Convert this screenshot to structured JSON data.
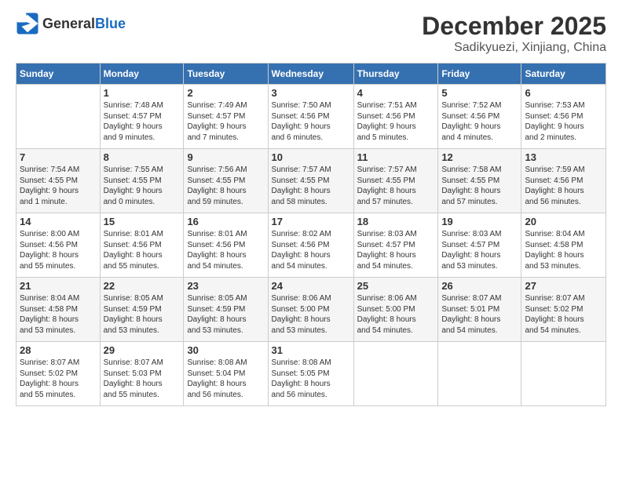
{
  "header": {
    "logo_general": "General",
    "logo_blue": "Blue",
    "title": "December 2025",
    "location": "Sadikyuezi, Xinjiang, China"
  },
  "days_of_week": [
    "Sunday",
    "Monday",
    "Tuesday",
    "Wednesday",
    "Thursday",
    "Friday",
    "Saturday"
  ],
  "weeks": [
    [
      {
        "day": "",
        "info": ""
      },
      {
        "day": "1",
        "info": "Sunrise: 7:48 AM\nSunset: 4:57 PM\nDaylight: 9 hours\nand 9 minutes."
      },
      {
        "day": "2",
        "info": "Sunrise: 7:49 AM\nSunset: 4:57 PM\nDaylight: 9 hours\nand 7 minutes."
      },
      {
        "day": "3",
        "info": "Sunrise: 7:50 AM\nSunset: 4:56 PM\nDaylight: 9 hours\nand 6 minutes."
      },
      {
        "day": "4",
        "info": "Sunrise: 7:51 AM\nSunset: 4:56 PM\nDaylight: 9 hours\nand 5 minutes."
      },
      {
        "day": "5",
        "info": "Sunrise: 7:52 AM\nSunset: 4:56 PM\nDaylight: 9 hours\nand 4 minutes."
      },
      {
        "day": "6",
        "info": "Sunrise: 7:53 AM\nSunset: 4:56 PM\nDaylight: 9 hours\nand 2 minutes."
      }
    ],
    [
      {
        "day": "7",
        "info": "Sunrise: 7:54 AM\nSunset: 4:55 PM\nDaylight: 9 hours\nand 1 minute."
      },
      {
        "day": "8",
        "info": "Sunrise: 7:55 AM\nSunset: 4:55 PM\nDaylight: 9 hours\nand 0 minutes."
      },
      {
        "day": "9",
        "info": "Sunrise: 7:56 AM\nSunset: 4:55 PM\nDaylight: 8 hours\nand 59 minutes."
      },
      {
        "day": "10",
        "info": "Sunrise: 7:57 AM\nSunset: 4:55 PM\nDaylight: 8 hours\nand 58 minutes."
      },
      {
        "day": "11",
        "info": "Sunrise: 7:57 AM\nSunset: 4:55 PM\nDaylight: 8 hours\nand 57 minutes."
      },
      {
        "day": "12",
        "info": "Sunrise: 7:58 AM\nSunset: 4:55 PM\nDaylight: 8 hours\nand 57 minutes."
      },
      {
        "day": "13",
        "info": "Sunrise: 7:59 AM\nSunset: 4:56 PM\nDaylight: 8 hours\nand 56 minutes."
      }
    ],
    [
      {
        "day": "14",
        "info": "Sunrise: 8:00 AM\nSunset: 4:56 PM\nDaylight: 8 hours\nand 55 minutes."
      },
      {
        "day": "15",
        "info": "Sunrise: 8:01 AM\nSunset: 4:56 PM\nDaylight: 8 hours\nand 55 minutes."
      },
      {
        "day": "16",
        "info": "Sunrise: 8:01 AM\nSunset: 4:56 PM\nDaylight: 8 hours\nand 54 minutes."
      },
      {
        "day": "17",
        "info": "Sunrise: 8:02 AM\nSunset: 4:56 PM\nDaylight: 8 hours\nand 54 minutes."
      },
      {
        "day": "18",
        "info": "Sunrise: 8:03 AM\nSunset: 4:57 PM\nDaylight: 8 hours\nand 54 minutes."
      },
      {
        "day": "19",
        "info": "Sunrise: 8:03 AM\nSunset: 4:57 PM\nDaylight: 8 hours\nand 53 minutes."
      },
      {
        "day": "20",
        "info": "Sunrise: 8:04 AM\nSunset: 4:58 PM\nDaylight: 8 hours\nand 53 minutes."
      }
    ],
    [
      {
        "day": "21",
        "info": "Sunrise: 8:04 AM\nSunset: 4:58 PM\nDaylight: 8 hours\nand 53 minutes."
      },
      {
        "day": "22",
        "info": "Sunrise: 8:05 AM\nSunset: 4:59 PM\nDaylight: 8 hours\nand 53 minutes."
      },
      {
        "day": "23",
        "info": "Sunrise: 8:05 AM\nSunset: 4:59 PM\nDaylight: 8 hours\nand 53 minutes."
      },
      {
        "day": "24",
        "info": "Sunrise: 8:06 AM\nSunset: 5:00 PM\nDaylight: 8 hours\nand 53 minutes."
      },
      {
        "day": "25",
        "info": "Sunrise: 8:06 AM\nSunset: 5:00 PM\nDaylight: 8 hours\nand 54 minutes."
      },
      {
        "day": "26",
        "info": "Sunrise: 8:07 AM\nSunset: 5:01 PM\nDaylight: 8 hours\nand 54 minutes."
      },
      {
        "day": "27",
        "info": "Sunrise: 8:07 AM\nSunset: 5:02 PM\nDaylight: 8 hours\nand 54 minutes."
      }
    ],
    [
      {
        "day": "28",
        "info": "Sunrise: 8:07 AM\nSunset: 5:02 PM\nDaylight: 8 hours\nand 55 minutes."
      },
      {
        "day": "29",
        "info": "Sunrise: 8:07 AM\nSunset: 5:03 PM\nDaylight: 8 hours\nand 55 minutes."
      },
      {
        "day": "30",
        "info": "Sunrise: 8:08 AM\nSunset: 5:04 PM\nDaylight: 8 hours\nand 56 minutes."
      },
      {
        "day": "31",
        "info": "Sunrise: 8:08 AM\nSunset: 5:05 PM\nDaylight: 8 hours\nand 56 minutes."
      },
      {
        "day": "",
        "info": ""
      },
      {
        "day": "",
        "info": ""
      },
      {
        "day": "",
        "info": ""
      }
    ]
  ]
}
